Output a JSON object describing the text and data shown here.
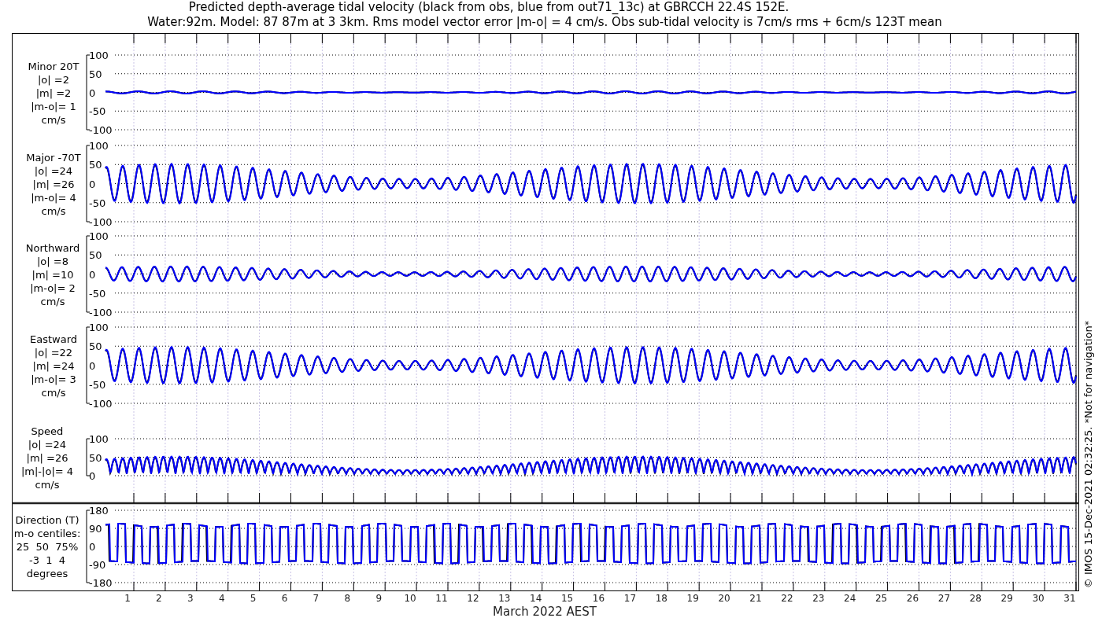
{
  "title": {
    "lines": [
      "Predicted depth-average tidal velocity (black from obs, blue from out71_13c) at GBRCCH 22.4S 152E.",
      "Water:92m. Model: 87 87m at 3 3km. Rms model vector error |m-o| = 4 cm/s. Obs sub-tidal velocity is 7cm/s rms + 6cm/s 123T mean"
    ]
  },
  "panels": [
    {
      "kind": "minor",
      "label_lines": [
        "Minor 20T",
        "|o| =2",
        "|m| =2",
        "|m-o|= 1",
        "cm/s"
      ],
      "yticks": [
        "100",
        "50",
        "0",
        "-50",
        "-100"
      ]
    },
    {
      "kind": "major",
      "label_lines": [
        "Major -70T",
        "|o| =24",
        "|m| =26",
        "|m-o|= 4",
        "cm/s"
      ],
      "yticks": [
        "100",
        "50",
        "0",
        "-50",
        "-100"
      ]
    },
    {
      "kind": "northward",
      "label_lines": [
        "Northward",
        "|o| =8",
        "|m| =10",
        "|m-o|= 2",
        "cm/s"
      ],
      "yticks": [
        "100",
        "50",
        "0",
        "-50",
        "-100"
      ]
    },
    {
      "kind": "eastward",
      "label_lines": [
        "Eastward",
        "|o| =22",
        "|m| =24",
        "|m-o|= 3",
        "cm/s"
      ],
      "yticks": [
        "100",
        "50",
        "0",
        "-50",
        "-100"
      ]
    },
    {
      "kind": "speed",
      "label_lines": [
        "Speed",
        "|o| =24",
        "|m| =26",
        "|m|-|o|= 4",
        "cm/s"
      ],
      "yticks": [
        "100",
        "50",
        "0"
      ]
    },
    {
      "kind": "direction",
      "label_lines": [
        "Direction (T)",
        "m-o centiles:",
        "25  50  75%",
        "-3  1  4",
        "degrees"
      ],
      "yticks": [
        "180",
        "90",
        "0",
        "-90",
        "-180"
      ]
    }
  ],
  "x_axis": {
    "ticks": [
      "1",
      "2",
      "3",
      "4",
      "5",
      "6",
      "7",
      "8",
      "9",
      "10",
      "11",
      "12",
      "13",
      "14",
      "15",
      "16",
      "17",
      "18",
      "19",
      "20",
      "21",
      "22",
      "23",
      "24",
      "25",
      "26",
      "27",
      "28",
      "29",
      "30",
      "31"
    ],
    "label": "March 2022 AEST"
  },
  "footer_note": "© IMOS 15-Dec-2021 02:32:25. *Not for navigation*"
}
